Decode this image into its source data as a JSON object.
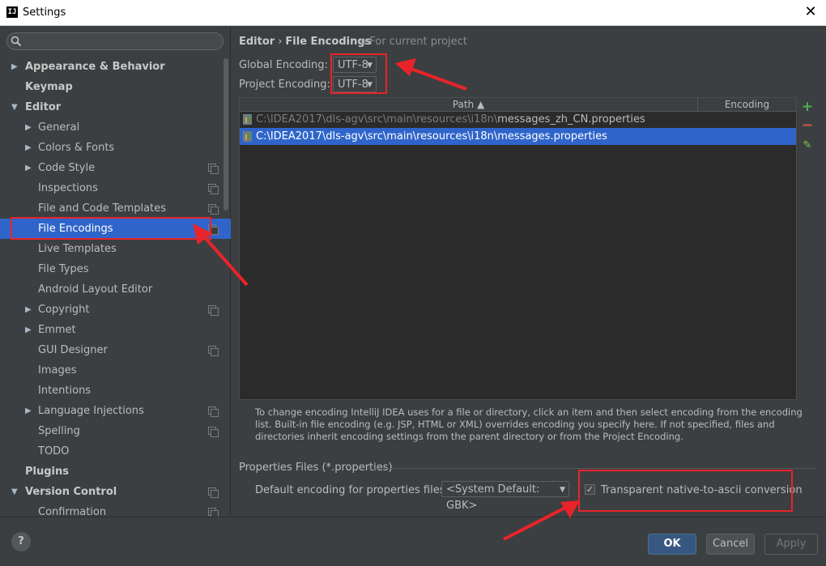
{
  "window": {
    "title": "Settings",
    "app_icon": "IJ",
    "close_glyph": "✕"
  },
  "sidebar": {
    "search_placeholder": "",
    "items": [
      {
        "label": "Appearance & Behavior",
        "level": 0,
        "expandable": true,
        "expanded": false,
        "bold": true
      },
      {
        "label": "Keymap",
        "level": 0,
        "expandable": false,
        "bold": true
      },
      {
        "label": "Editor",
        "level": 0,
        "expandable": true,
        "expanded": true,
        "bold": true
      },
      {
        "label": "General",
        "level": 1,
        "expandable": true,
        "expanded": false
      },
      {
        "label": "Colors & Fonts",
        "level": 1,
        "expandable": true,
        "expanded": false
      },
      {
        "label": "Code Style",
        "level": 1,
        "expandable": true,
        "expanded": false,
        "project": true
      },
      {
        "label": "Inspections",
        "level": 1,
        "project": true
      },
      {
        "label": "File and Code Templates",
        "level": 1,
        "project": true
      },
      {
        "label": "File Encodings",
        "level": 1,
        "project": true,
        "selected": true
      },
      {
        "label": "Live Templates",
        "level": 1
      },
      {
        "label": "File Types",
        "level": 1
      },
      {
        "label": "Android Layout Editor",
        "level": 1
      },
      {
        "label": "Copyright",
        "level": 1,
        "expandable": true,
        "expanded": false,
        "project": true
      },
      {
        "label": "Emmet",
        "level": 1,
        "expandable": true,
        "expanded": false
      },
      {
        "label": "GUI Designer",
        "level": 1,
        "project": true
      },
      {
        "label": "Images",
        "level": 1
      },
      {
        "label": "Intentions",
        "level": 1
      },
      {
        "label": "Language Injections",
        "level": 1,
        "expandable": true,
        "expanded": false,
        "project": true
      },
      {
        "label": "Spelling",
        "level": 1,
        "project": true
      },
      {
        "label": "TODO",
        "level": 1
      },
      {
        "label": "Plugins",
        "level": 0,
        "bold": true
      },
      {
        "label": "Version Control",
        "level": 0,
        "expandable": true,
        "expanded": true,
        "bold": true,
        "project": true
      },
      {
        "label": "Confirmation",
        "level": 1,
        "project": true
      }
    ]
  },
  "main": {
    "breadcrumb": {
      "parent": "Editor",
      "separator": "›",
      "current": "File Encodings",
      "note": "For current project"
    },
    "global_encoding": {
      "label": "Global Encoding:",
      "value": "UTF-8"
    },
    "project_encoding": {
      "label": "Project Encoding:",
      "value": "UTF-8"
    },
    "table": {
      "columns": [
        "Path ▲",
        "Encoding"
      ],
      "rows": [
        {
          "dir": "C:\\IDEA2017\\dls-agv\\src\\main\\resources\\i18n\\",
          "file": "messages_zh_CN.properties",
          "encoding": "",
          "selected": false
        },
        {
          "dir": "C:\\IDEA2017\\dls-agv\\src\\main\\resources\\i18n\\",
          "file": "messages.properties",
          "encoding": "",
          "selected": true
        }
      ],
      "buttons": {
        "add": "+",
        "remove": "−",
        "edit": "✎"
      }
    },
    "help_text": "To change encoding IntelliJ IDEA uses for a file or directory, click an item and then select encoding from the encoding list. Built-in file encoding (e.g. JSP, HTML or XML) overrides encoding you specify here. If not specified, files and directories inherit encoding settings from the parent directory or from the Project Encoding.",
    "properties_section": {
      "title": "Properties Files (*.properties)",
      "default_label": "Default encoding for properties files:",
      "default_value": "<System Default: GBK>",
      "checkbox_label": "Transparent native-to-ascii conversion",
      "checkbox_checked": true
    }
  },
  "footer": {
    "help": "?",
    "ok": "OK",
    "cancel": "Cancel",
    "apply": "Apply"
  },
  "colors": {
    "annotation": "#e8242a",
    "selection": "#2f65ca",
    "background": "#3c3f41"
  }
}
